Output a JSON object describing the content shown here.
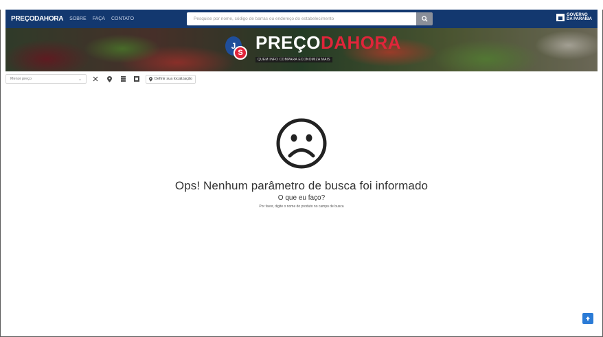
{
  "navbar": {
    "brand": "PREÇODAHORA",
    "links": [
      "SOBRE",
      "FAÇA",
      "CONTATO"
    ],
    "search_placeholder": "Pesquise por nome, código de barras ou endereço do estabelecimento",
    "gov_text_line1": "GOVERNO",
    "gov_text_line2": "DA PARAÍBA"
  },
  "banner": {
    "logo_j": "J",
    "logo_s": "S",
    "logo_preco": "PREÇO",
    "logo_dahora": "DAHORA",
    "tagline": "QUEM INFO COMPARA ECONOMIZA MAIS"
  },
  "toolbar": {
    "select_value": "Menor preço",
    "location_label": "Definir sua localização"
  },
  "message": {
    "face": "☹",
    "headline": "Ops! Nenhum parâmetro de busca foi informado",
    "subheadline": "O que eu faço?",
    "hint": "Por favor, digite o nome do produto no campo de busca"
  },
  "colors": {
    "navbar_bg": "#13386f",
    "brand_red": "#e0253a",
    "brand_blue": "#1f4e9a",
    "float_button": "#2b7bd6"
  },
  "icons": {
    "search": "search-icon",
    "close": "close-icon",
    "pin": "map-pin-icon",
    "list": "list-icon",
    "grid": "grid-icon",
    "top": "arrow-up-icon"
  }
}
